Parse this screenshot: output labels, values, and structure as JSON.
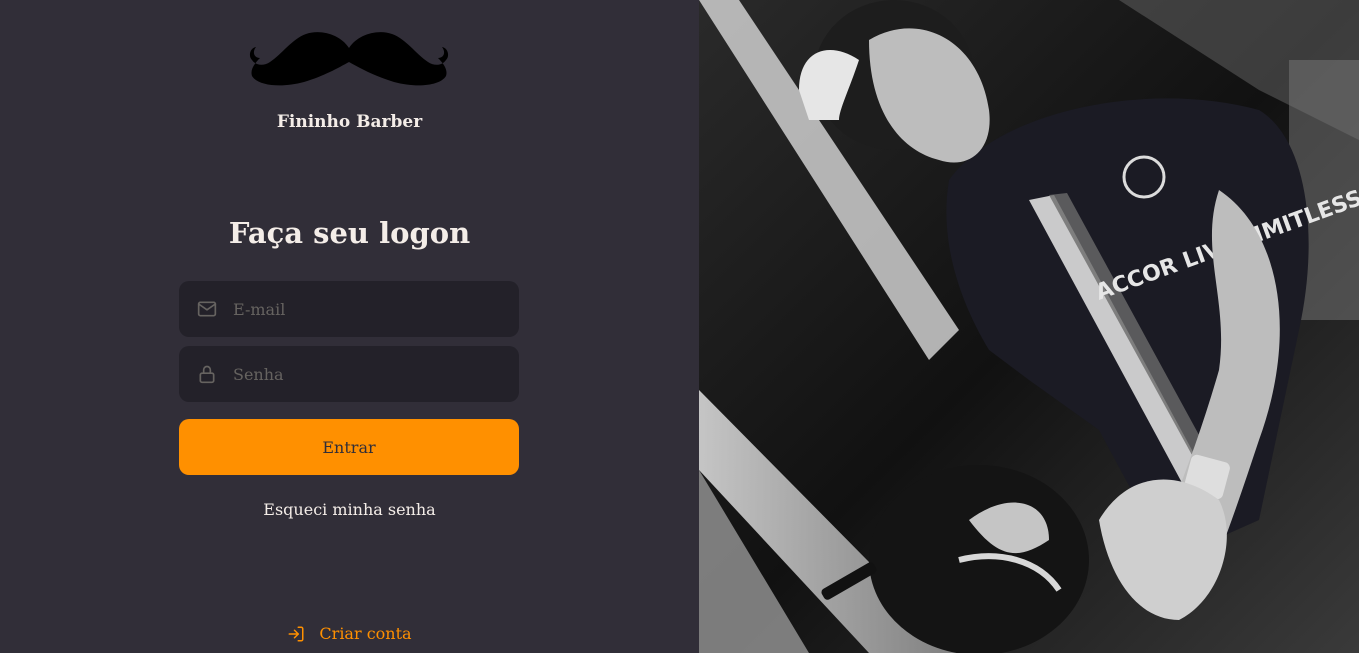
{
  "brand": {
    "name": "Fininho Barber",
    "logo_icon": "mustache-icon"
  },
  "login": {
    "title": "Faça seu logon",
    "email": {
      "placeholder": "E-mail",
      "value": "",
      "icon": "mail-icon"
    },
    "password": {
      "placeholder": "Senha",
      "value": "",
      "icon": "lock-icon"
    },
    "submit_label": "Entrar",
    "forgot_label": "Esqueci minha senha"
  },
  "signup": {
    "label": "Criar conta",
    "icon": "log-in-icon"
  },
  "colors": {
    "background": "#312e38",
    "input_background": "#232129",
    "accent": "#ff9000",
    "text": "#f4ede8",
    "placeholder": "#666360"
  }
}
